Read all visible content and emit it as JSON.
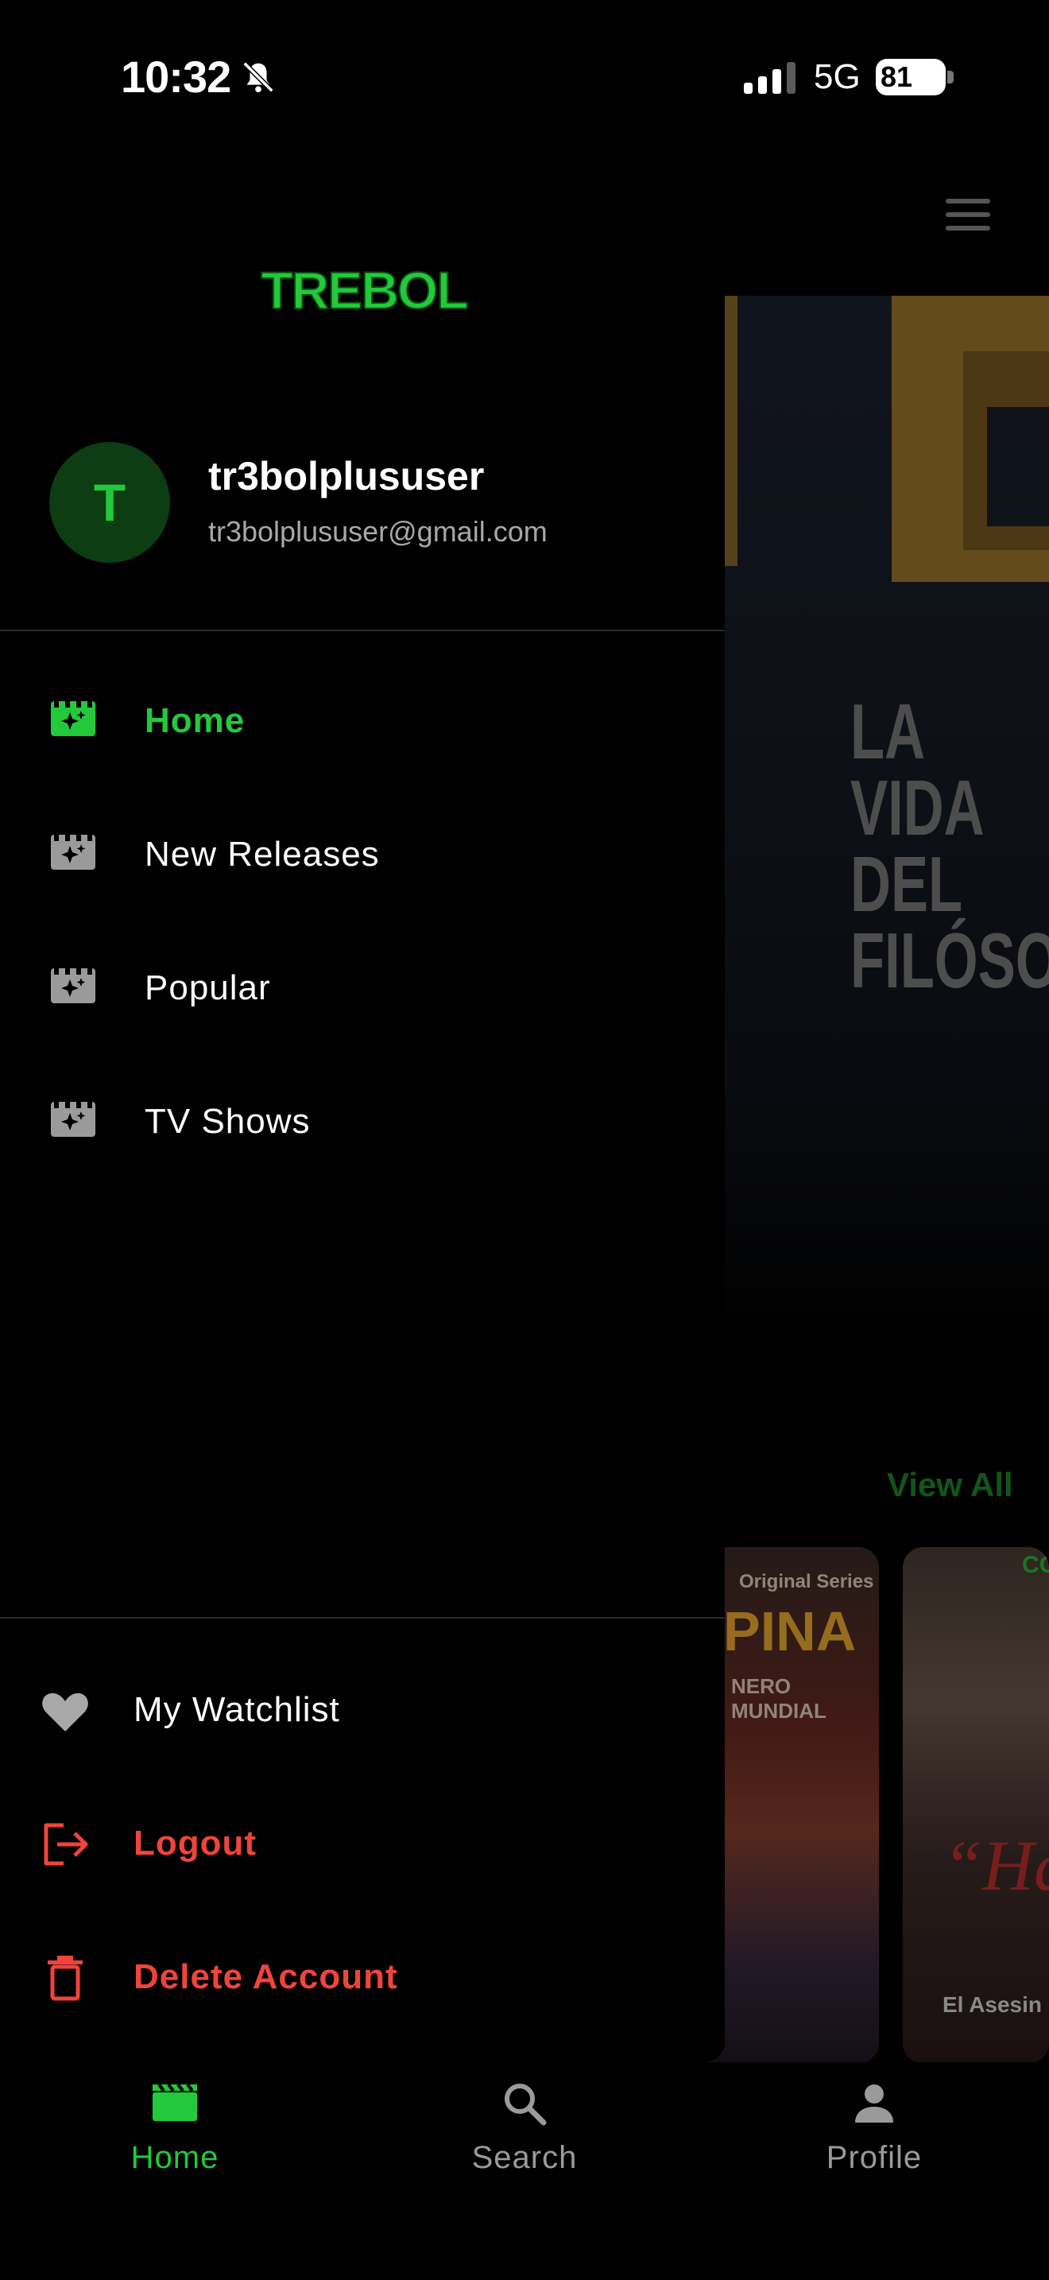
{
  "status_bar": {
    "time": "10:32",
    "network": "5G",
    "battery": "81"
  },
  "colors": {
    "accent": "#22c93a",
    "danger": "#f0443a",
    "background": "#000000"
  },
  "background_screen": {
    "hero_letter": "C",
    "hero_subtitle": "LA VIDA DEL FILÓSO",
    "section_view_all": "View All",
    "posters": [
      {
        "badge": "Original Series",
        "title": "PINA",
        "subtitle": "NERO MUNDIAL"
      },
      {
        "tag": "CO",
        "script": "“Hasta",
        "caption": "El Asesin"
      }
    ]
  },
  "drawer": {
    "logo_text": "TREBOL",
    "user": {
      "initial": "T",
      "name": "tr3bolplususer",
      "email": "tr3bolplususer@gmail.com"
    },
    "nav_items": [
      {
        "label": "Home",
        "icon": "movie-sparkle-icon",
        "active": true
      },
      {
        "label": "New Releases",
        "icon": "movie-sparkle-icon",
        "active": false
      },
      {
        "label": "Popular",
        "icon": "movie-sparkle-icon",
        "active": false
      },
      {
        "label": "TV Shows",
        "icon": "movie-sparkle-icon",
        "active": false
      }
    ],
    "bottom_items": [
      {
        "label": "My Watchlist",
        "icon": "heart-icon"
      },
      {
        "label": "Logout",
        "icon": "logout-icon"
      },
      {
        "label": "Delete Account",
        "icon": "trash-icon"
      }
    ]
  },
  "tab_bar": {
    "tabs": [
      {
        "label": "Home",
        "icon": "clapperboard-icon",
        "active": true
      },
      {
        "label": "Search",
        "icon": "search-icon",
        "active": false
      },
      {
        "label": "Profile",
        "icon": "person-icon",
        "active": false
      }
    ]
  }
}
